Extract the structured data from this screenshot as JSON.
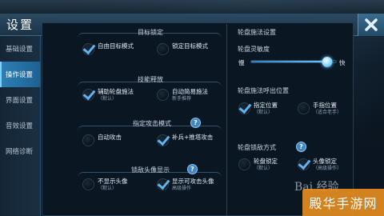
{
  "header": {
    "title": "设置"
  },
  "sidebar": {
    "items": [
      {
        "label": "基础设置"
      },
      {
        "label": "操作设置"
      },
      {
        "label": "界面设置"
      },
      {
        "label": "音效设置"
      },
      {
        "label": "网络诊断"
      }
    ],
    "active_index": 1
  },
  "sections": {
    "target_lock": {
      "title": "目标锁定",
      "options": [
        {
          "label": "自由目标模式",
          "checked": true
        },
        {
          "label": "锁定目标模式",
          "checked": false
        }
      ]
    },
    "skill_release": {
      "title": "技能释放",
      "options": [
        {
          "label": "辅助轮盘施法",
          "sub": "（默认）",
          "checked": true
        },
        {
          "label": "自动简易施法",
          "sub": "新手推荐",
          "checked": false
        }
      ]
    },
    "attack_mode": {
      "title": "指定攻击模式",
      "options": [
        {
          "label": "自动攻击",
          "checked": false
        },
        {
          "label": "补兵+推塔攻击",
          "checked": true
        }
      ]
    },
    "enemy_avatar": {
      "title": "锁敌头像显示",
      "options": [
        {
          "label": "不显示头像",
          "sub": "（默认）",
          "checked": false
        },
        {
          "label": "显示可攻击头像",
          "sub": "高级操作",
          "checked": true
        }
      ]
    },
    "wheel_cast": {
      "title": "轮盘施法设置",
      "sensitivity_label": "轮盘灵敏度",
      "slow_label": "慢",
      "fast_label": "快",
      "sensitivity_value": 0.9
    },
    "wheel_call_position": {
      "title": "轮盘施法呼出位置",
      "options": [
        {
          "label": "指定位置",
          "sub": "（默认）",
          "checked": true
        },
        {
          "label": "手指位置",
          "sub": "（适合老手）",
          "checked": false
        }
      ]
    },
    "wheel_lock_mode": {
      "title": "轮盘锁敌方式",
      "options": [
        {
          "label": "轮盘锁定",
          "sub": "（默认）",
          "checked": false
        },
        {
          "label": "头像锁定",
          "sub": "（高级操作）",
          "checked": true
        }
      ]
    }
  },
  "watermark": {
    "text": "Bai 经验",
    "badge": "殿华手游网"
  },
  "colors": {
    "accent": "#2d7fb5",
    "check": "#5fb3f0",
    "help": "#3e86c5",
    "badge": "#e88e1e"
  }
}
